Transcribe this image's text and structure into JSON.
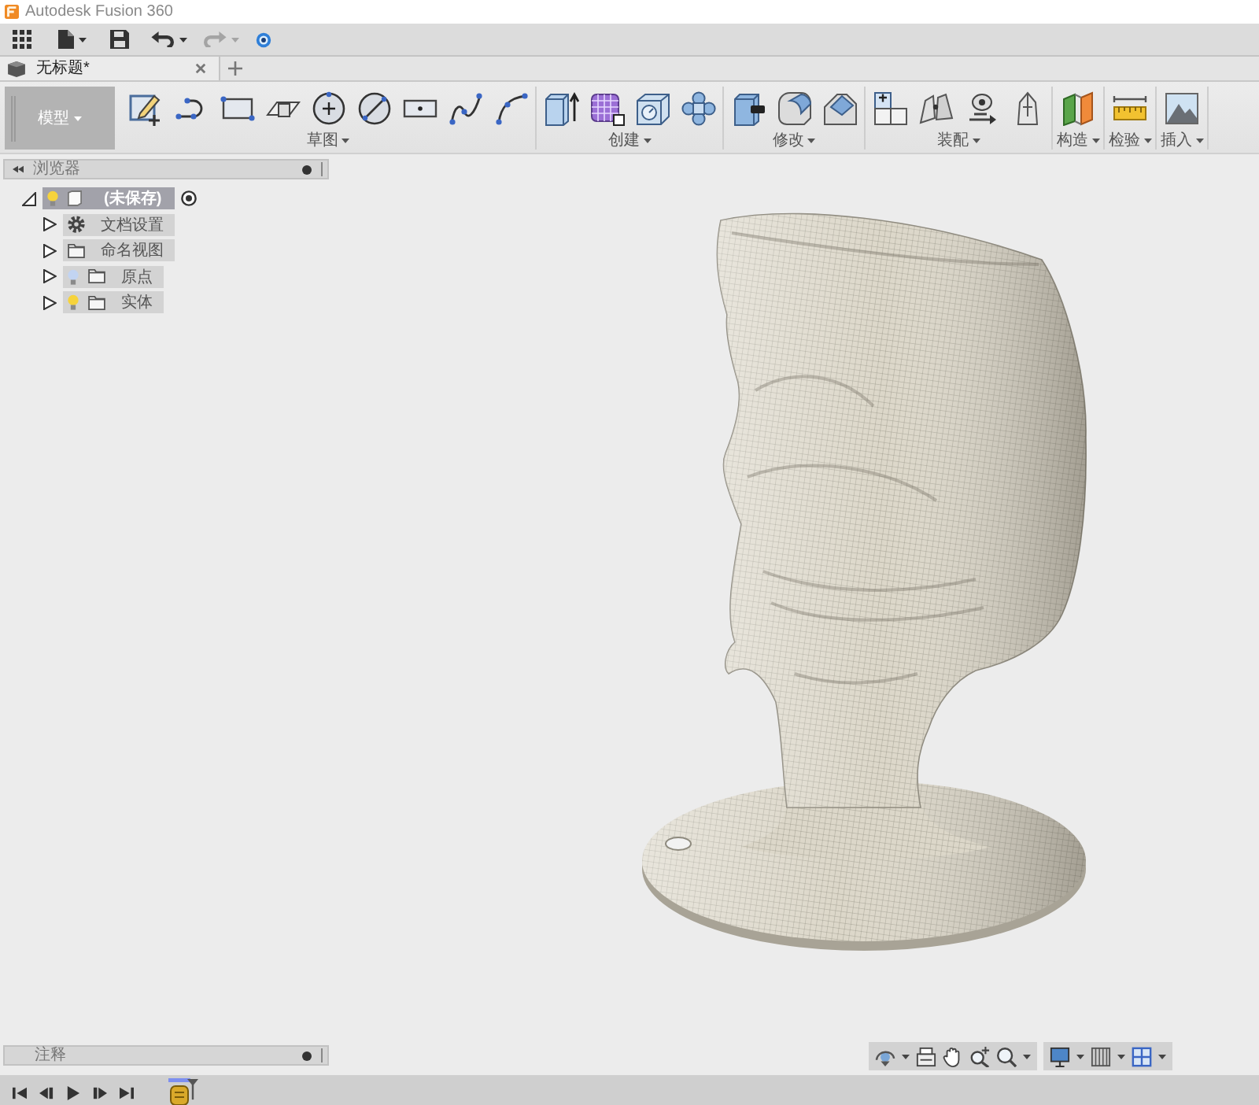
{
  "window": {
    "title": "Autodesk Fusion 360"
  },
  "quick_access": {
    "undo": {
      "disabled": false
    },
    "redo": {
      "disabled": true
    }
  },
  "document_tab": {
    "title": "无标题*"
  },
  "toolbar": {
    "workspace": "模型",
    "groups": [
      {
        "label": "草图"
      },
      {
        "label": "创建"
      },
      {
        "label": "修改"
      },
      {
        "label": "装配"
      },
      {
        "label": "构造"
      },
      {
        "label": "检验"
      },
      {
        "label": "插入"
      }
    ]
  },
  "browser": {
    "title": "浏览器",
    "root": {
      "label": "(未保存)",
      "selected": true,
      "expanded": true,
      "visible": true,
      "active": true,
      "children": [
        {
          "label": "文档设置",
          "kind": "settings",
          "selected": false,
          "expanded": false
        },
        {
          "label": "命名视图",
          "kind": "folder",
          "selected": false,
          "expanded": false
        },
        {
          "label": "原点",
          "kind": "folder",
          "selected": false,
          "expanded": false,
          "visible": false
        },
        {
          "label": "实体",
          "kind": "folder",
          "selected": false,
          "expanded": false,
          "visible": true
        }
      ]
    }
  },
  "comments": {
    "title": "注释"
  }
}
